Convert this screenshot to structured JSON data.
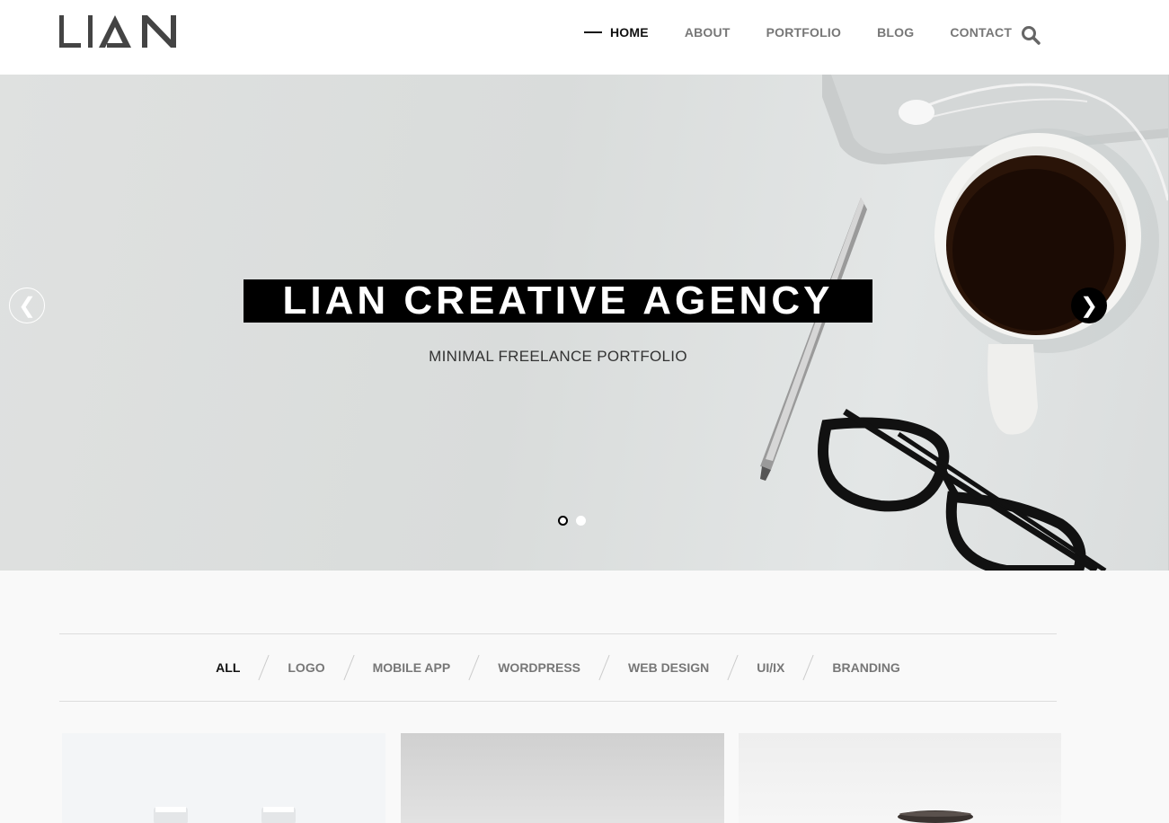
{
  "brand": {
    "logo_text": "LIAN"
  },
  "nav": {
    "items": [
      {
        "label": "HOME",
        "active": true
      },
      {
        "label": "ABOUT",
        "active": false
      },
      {
        "label": "PORTFOLIO",
        "active": false
      },
      {
        "label": "BLOG",
        "active": false
      },
      {
        "label": "CONTACT",
        "active": false
      }
    ],
    "search_icon": "search-icon"
  },
  "hero": {
    "title": "LIAN CREATIVE AGENCY",
    "subtitle": "MINIMAL FREELANCE PORTFOLIO",
    "prev_arrow": "❮",
    "next_arrow": "❯",
    "slides_count": 2,
    "active_slide": 1
  },
  "portfolio_filter": {
    "items": [
      {
        "label": "ALL",
        "active": true
      },
      {
        "label": "LOGO",
        "active": false
      },
      {
        "label": "MOBILE APP",
        "active": false
      },
      {
        "label": "WORDPRESS",
        "active": false
      },
      {
        "label": "WEB DESIGN",
        "active": false
      },
      {
        "label": "UI/IX",
        "active": false
      },
      {
        "label": "BRANDING",
        "active": false
      }
    ]
  },
  "colors": {
    "accent": "#000000",
    "nav_active": "#111111",
    "nav_inactive": "#777777",
    "page_bg": "#f9f9f9"
  }
}
